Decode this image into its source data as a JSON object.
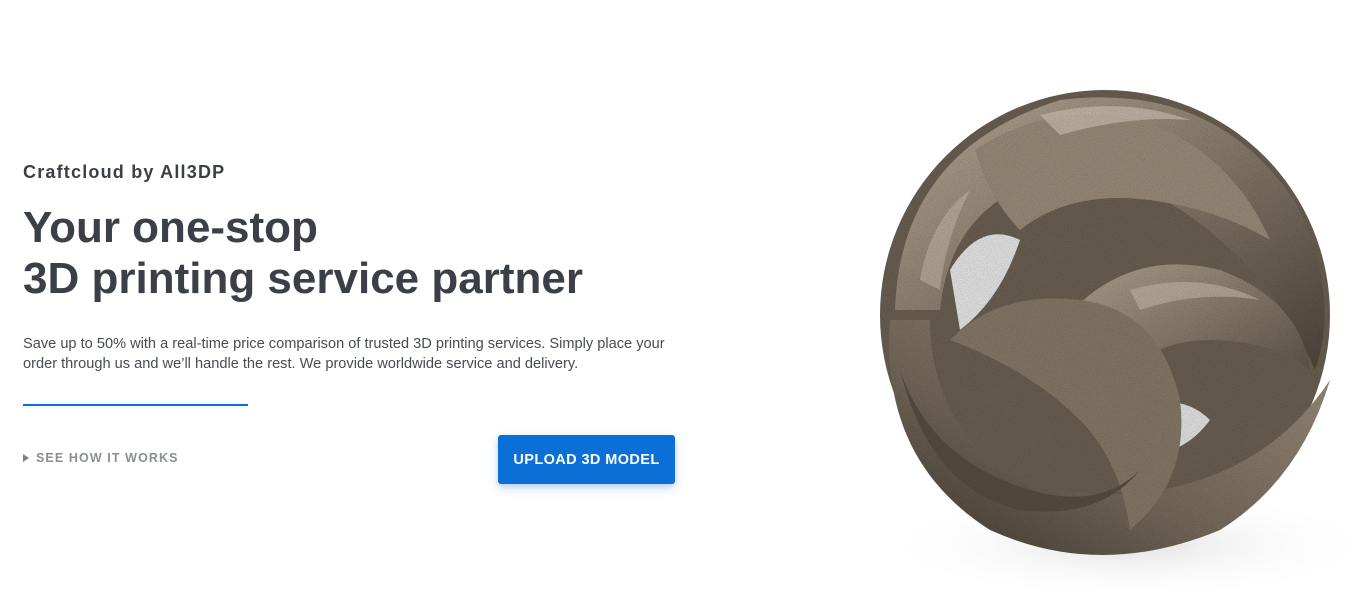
{
  "hero": {
    "brand": "Craftcloud by All3DP",
    "headline_line1": "Your one-stop",
    "headline_line2": "3D printing service partner",
    "description": "Save up to 50% with a real-time price comparison of trusted 3D printing services. Simply place your order through us and we’ll handle the rest. We provide worldwide service and delivery.",
    "see_how_label": "SEE HOW IT WORKS",
    "upload_label": "UPLOAD 3D MODEL"
  },
  "icons": {
    "see_how": "play-triangle-icon"
  },
  "colors": {
    "accent": "#0a6fd6",
    "heading": "#3b3f47",
    "body_text": "#474b53",
    "muted": "#8a8e96",
    "metal_light": "#b8aa96",
    "metal_dark": "#4f463b"
  }
}
